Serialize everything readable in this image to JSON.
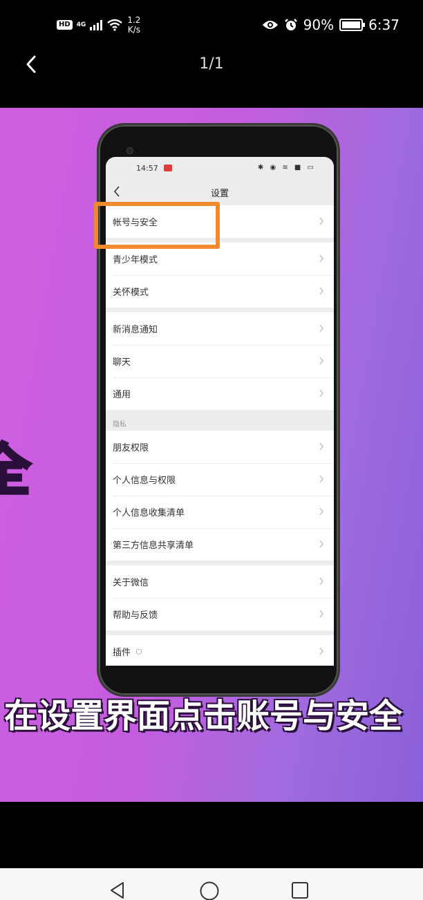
{
  "status_bar": {
    "network": "4G",
    "speed_value": "1.2",
    "speed_unit": "K/s",
    "battery": "90%",
    "time": "6:37",
    "icons": [
      "hd-icon",
      "signal-icon",
      "wifi-icon",
      "eye-icon",
      "alarm-icon",
      "battery-icon"
    ]
  },
  "viewer": {
    "page_counter": "1/1"
  },
  "image": {
    "side_caption": "全",
    "bottom_caption": "在设置界面点击账号与安全",
    "colors": {
      "gradient_start": "#cf5fe0",
      "gradient_end": "#8a5fd8",
      "highlight": "#f08a2c"
    },
    "phone": {
      "status_time": "14:57",
      "title": "设置",
      "groups": [
        {
          "items": [
            "帐号与安全"
          ]
        },
        {
          "items": [
            "青少年模式",
            "关怀模式"
          ]
        },
        {
          "items": [
            "新消息通知",
            "聊天",
            "通用"
          ]
        },
        {
          "label": "隐私",
          "items": [
            "朋友权限",
            "个人信息与权限",
            "个人信息收集清单",
            "第三方信息共享清单"
          ]
        },
        {
          "items": [
            "关于微信",
            "帮助与反馈"
          ]
        },
        {
          "items": [
            "插件"
          ]
        }
      ]
    }
  },
  "nav_bar": {
    "buttons": [
      "back-triangle-icon",
      "home-circle-icon",
      "recents-square-icon"
    ]
  }
}
